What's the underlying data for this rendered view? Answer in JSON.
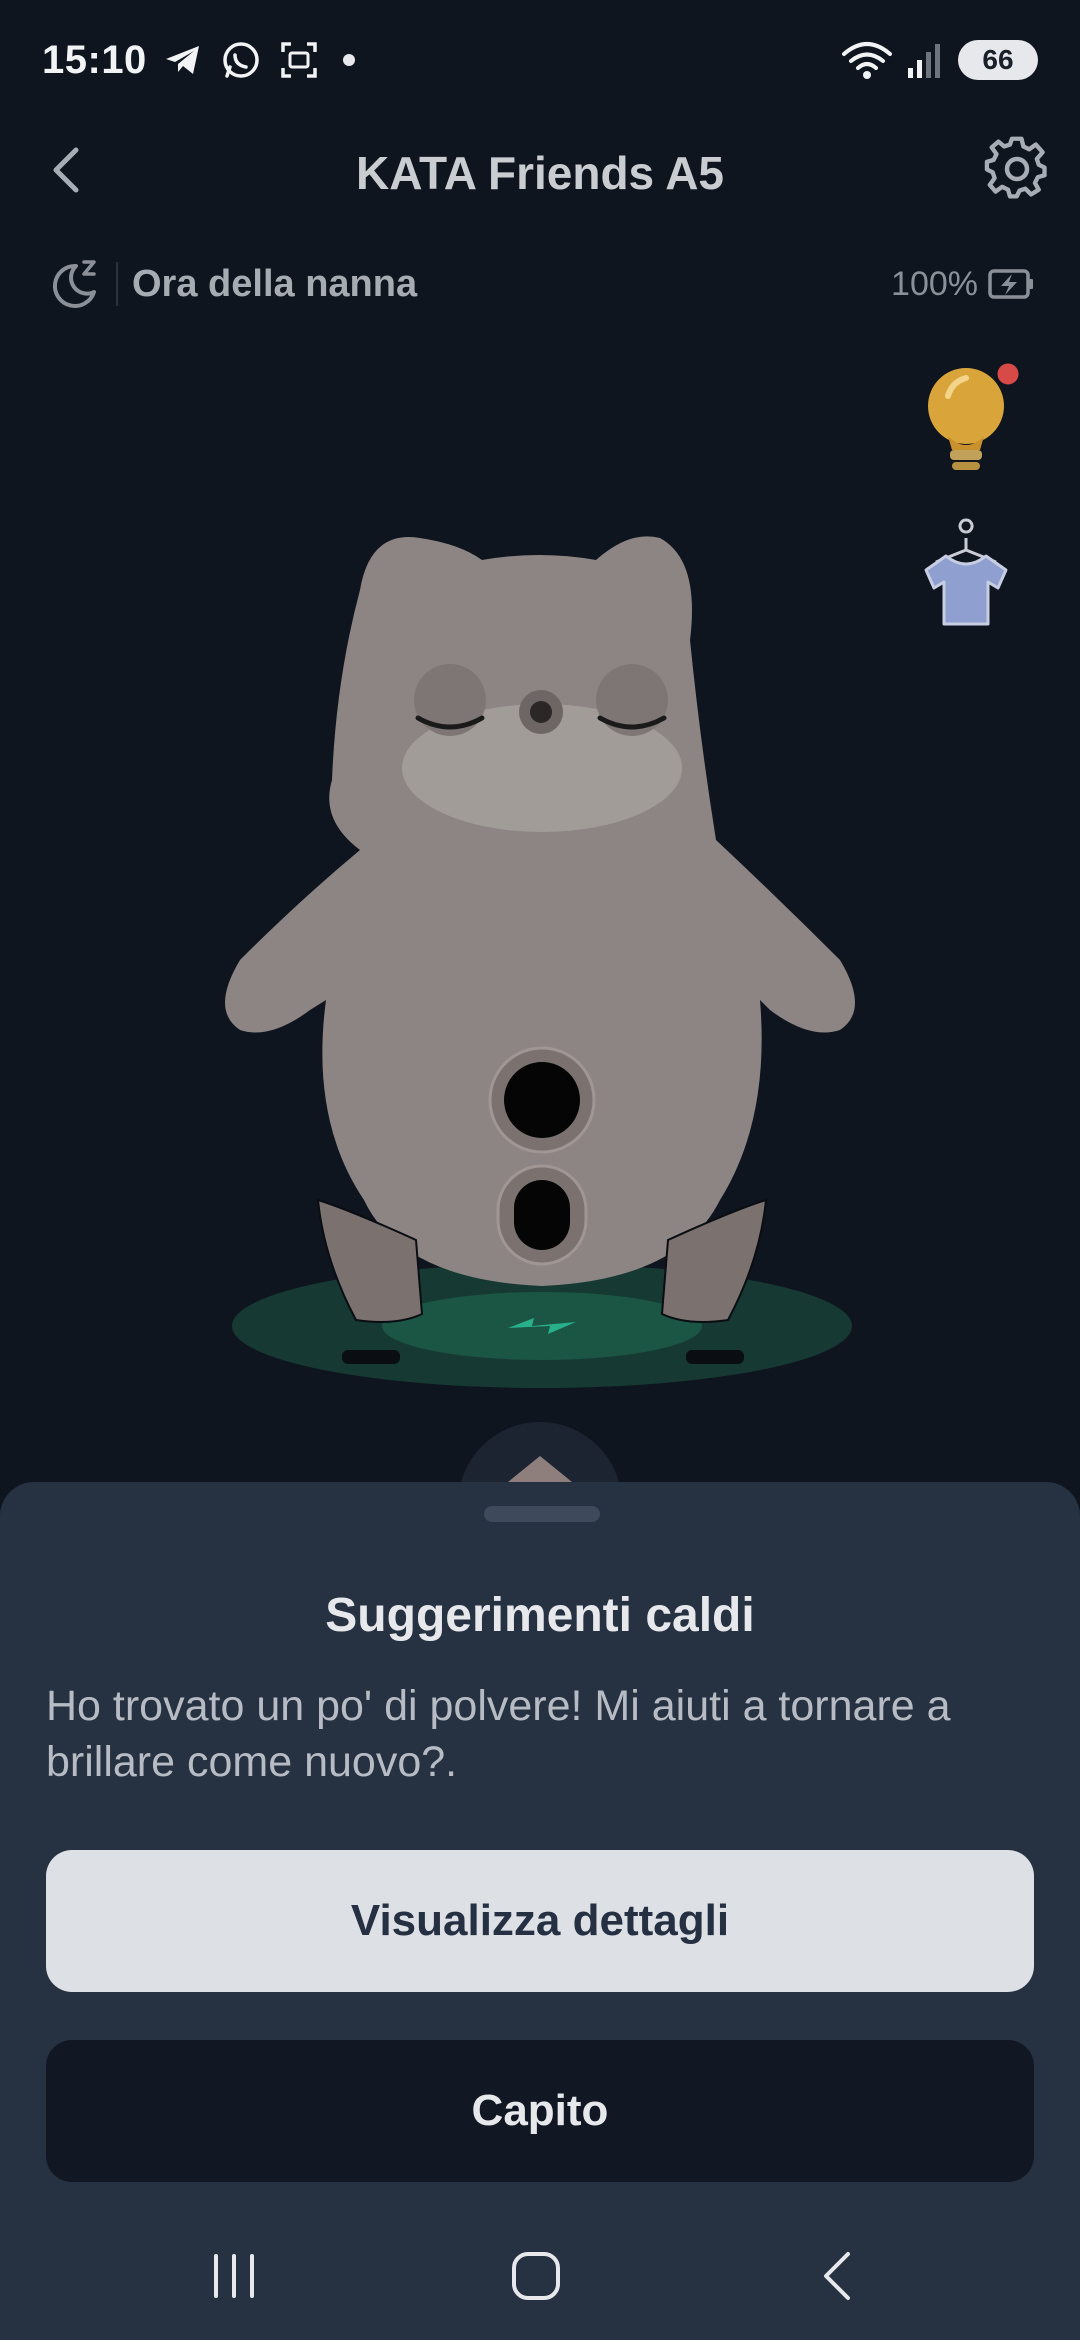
{
  "status_bar": {
    "time": "15:10",
    "battery_level": "66",
    "icons": [
      "telegram-icon",
      "whatsapp-icon",
      "screenshot-icon",
      "wifi-icon",
      "signal-icon"
    ]
  },
  "header": {
    "title": "KATA Friends A5",
    "back_icon": "back-arrow-icon",
    "settings_icon": "gear-icon"
  },
  "mode": {
    "label": "Ora della nanna",
    "icon": "moon-sleep-icon",
    "battery_percent": "100%",
    "battery_icon": "battery-charging-icon"
  },
  "side_buttons": [
    {
      "icon": "lightbulb-icon",
      "has_notification": true
    },
    {
      "icon": "shirt-hanger-icon",
      "has_notification": false
    }
  ],
  "sheet": {
    "title": "Suggerimenti caldi",
    "message": "Ho trovato un po' di polvere! Mi aiuti a tornare a brillare come nuovo?.",
    "primary_button": "Visualizza dettagli",
    "secondary_button": "Capito"
  },
  "nav_bar": {
    "buttons": [
      "recents-icon",
      "home-icon",
      "back-icon"
    ]
  },
  "colors": {
    "background": "#0f151f",
    "sheet": "#263141",
    "primary_button": "#dde0e5",
    "secondary_button": "#111723",
    "robot_body": "#8d8584",
    "charging_pad": "#1f8c6b"
  }
}
